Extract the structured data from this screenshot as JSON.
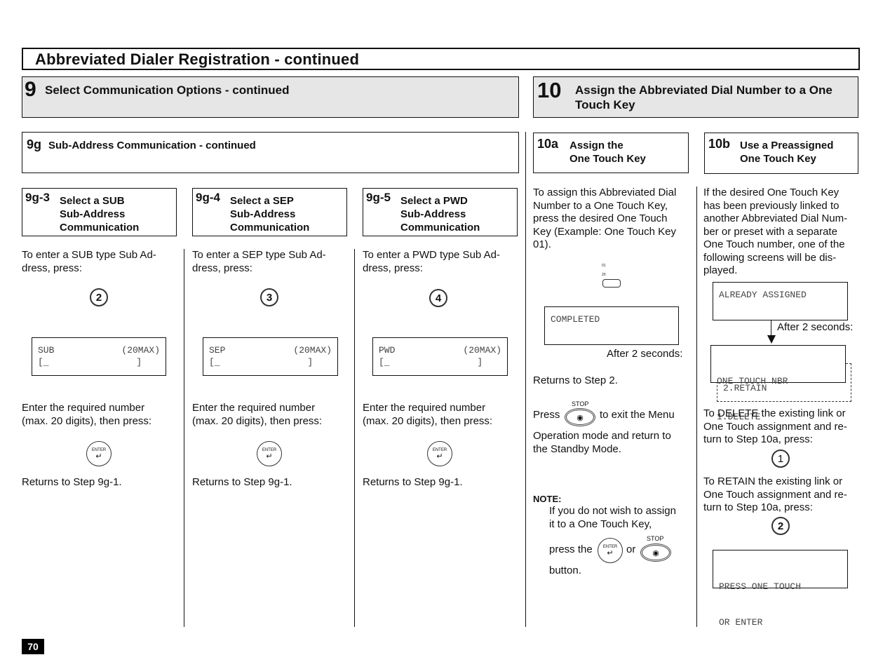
{
  "page": {
    "title": "Abbreviated Dialer Registration - continued",
    "page_number": "70"
  },
  "step9": {
    "number": "9",
    "title": "Select Communication Options - continued",
    "sub": {
      "number": "9g",
      "title": "Sub-Address Communication - continued"
    },
    "columns": [
      {
        "number": "9g-3",
        "title_lines": [
          "Select a SUB",
          "Sub-Address",
          "Communication"
        ],
        "intro_lines": [
          "To enter a SUB type Sub Ad-",
          "dress,  press:"
        ],
        "key": "2",
        "lcd_line1_left": "SUB",
        "lcd_line1_right": "(20MAX)",
        "lcd_line2": "[_                ]",
        "enter_lines": [
          "Enter the required number",
          "(max. 20 digits), then press:"
        ],
        "enter_key_label": "ENTER",
        "returns": "Returns to Step 9g-1."
      },
      {
        "number": "9g-4",
        "title_lines": [
          "Select a SEP",
          "Sub-Address",
          "Communication"
        ],
        "intro_lines": [
          "To enter a SEP type Sub Ad-",
          "dress,   press:"
        ],
        "key": "3",
        "lcd_line1_left": "SEP",
        "lcd_line1_right": "(20MAX)",
        "lcd_line2": "[_                ]",
        "enter_lines": [
          "Enter the required number",
          "(max. 20 digits), then press:"
        ],
        "enter_key_label": "ENTER",
        "returns": "Returns to Step 9g-1."
      },
      {
        "number": "9g-5",
        "title_lines": [
          "Select a PWD",
          "Sub-Address",
          "Communication"
        ],
        "intro_lines": [
          "To enter a PWD type Sub Ad-",
          "dress,  press:"
        ],
        "key": "4",
        "lcd_line1_left": "PWD",
        "lcd_line1_right": "(20MAX)",
        "lcd_line2": "[_                ]",
        "enter_lines": [
          "Enter the required number",
          "(max. 20 digits), then press:"
        ],
        "enter_key_label": "ENTER",
        "returns": "Returns to Step 9g-1."
      }
    ]
  },
  "step10": {
    "number": "10",
    "title_lines": [
      "Assign the Abbreviated Dial Number to a One",
      "Touch Key"
    ],
    "a": {
      "number": "10a",
      "title_lines": [
        "Assign the",
        "One Touch Key"
      ],
      "intro_lines": [
        "To assign this Abbreviated Dial",
        "Number to a One Touch Key,",
        "press the desired One Touch",
        "Key (Example: One Touch Key",
        "01)."
      ],
      "one_touch_labels": [
        "01",
        "20"
      ],
      "lcd": "COMPLETED",
      "after": "After 2 seconds:",
      "returns": "Returns  to Step 2.",
      "press_label": "Press",
      "stop_label": "STOP",
      "exit_text": "to exit the Menu",
      "exit_lines": [
        "Operation mode and return to",
        "the Standby Mode."
      ],
      "note": {
        "heading": "NOTE:",
        "lines": [
          "If you do not wish to assign",
          "it to a One Touch Key,"
        ],
        "press_the": "press the",
        "or": "or",
        "button": "button.",
        "enter_key_label": "ENTER",
        "stop_label": "STOP"
      }
    },
    "b": {
      "number": "10b",
      "title_lines": [
        "Use a Preassigned",
        "One Touch Key"
      ],
      "intro_lines": [
        "If the desired One Touch Key",
        "has been previously linked to",
        "another Abbreviated Dial Num-",
        "ber or preset with a separate",
        "One Touch number, one of the",
        "following screens will be dis-",
        "played."
      ],
      "lcd1": "ALREADY ASSIGNED",
      "after": "After 2 seconds:",
      "lcd2_lines": [
        "ONE TOUCH NBR",
        "1.DELETE"
      ],
      "lcd2_hidden": "2.RETAIN",
      "delete_lines": [
        "To DELETE the existing link or",
        "One Touch assignment and re-",
        "turn to Step 10a, press:"
      ],
      "delete_key": "1",
      "retain_lines": [
        "To RETAIN the existing link or",
        "One Touch assignment and re-",
        "turn to Step 10a, press:"
      ],
      "retain_key": "2",
      "lcd3_lines": [
        "PRESS ONE TOUCH",
        "OR ENTER"
      ]
    }
  }
}
